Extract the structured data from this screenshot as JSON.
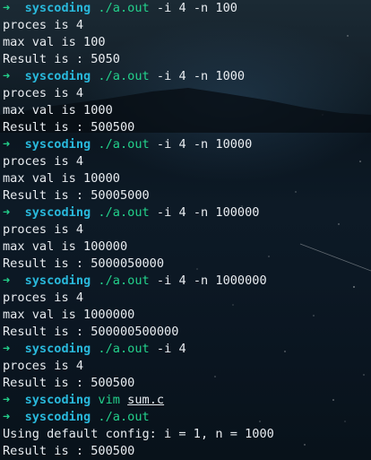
{
  "prompt": {
    "arrow": "➜",
    "dir": "syscoding"
  },
  "blocks": [
    {
      "command": "./a.out",
      "args": "-i 4 -n 100",
      "output": [
        "proces is 4",
        "max val is 100",
        "Result is : 5050"
      ]
    },
    {
      "command": "./a.out",
      "args": "-i 4 -n 1000",
      "output": [
        "proces is 4",
        "max val is 1000",
        "Result is : 500500"
      ]
    },
    {
      "command": "./a.out",
      "args": "-i 4 -n 10000",
      "output": [
        "proces is 4",
        "max val is 10000",
        "Result is : 50005000"
      ]
    },
    {
      "command": "./a.out",
      "args": "-i 4 -n 100000",
      "output": [
        "proces is 4",
        "max val is 100000",
        "Result is : 5000050000"
      ]
    },
    {
      "command": "./a.out",
      "args": "-i 4 -n 1000000",
      "output": [
        "proces is 4",
        "max val is 1000000",
        "Result is : 500000500000"
      ]
    },
    {
      "command": "./a.out",
      "args": "-i 4",
      "output": [
        "proces is 4",
        "Result is : 500500"
      ]
    },
    {
      "command": "vim",
      "args": "sum.c",
      "output": []
    },
    {
      "command": "./a.out",
      "args": "",
      "output": [
        "Using default config: i = 1, n = 1000",
        "Result is : 500500"
      ]
    }
  ],
  "colors": {
    "arrow": "#23d18b",
    "dir": "#29b8db",
    "command": "#23d18b",
    "text": "#e8ecf0"
  }
}
